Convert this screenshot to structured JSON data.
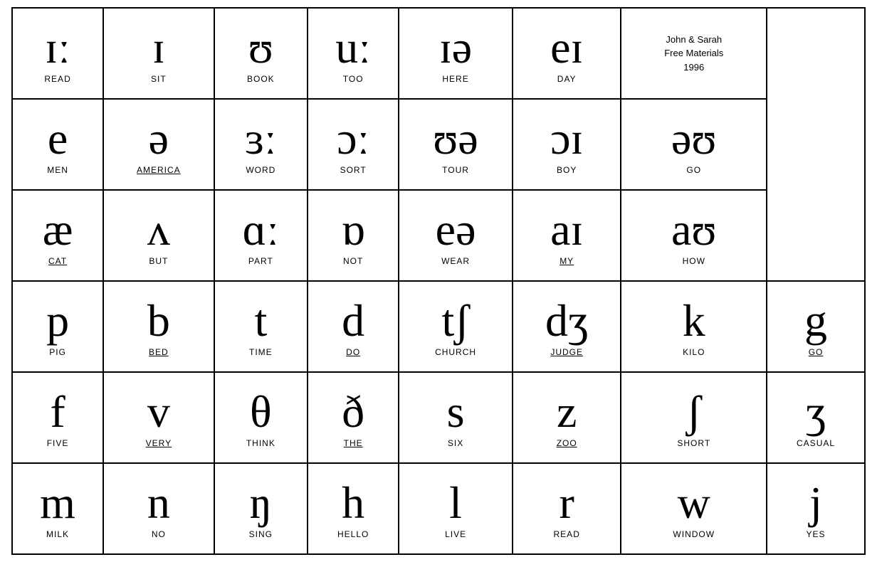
{
  "credit": {
    "line1": "John & Sarah",
    "line2": "Free Materials",
    "line3": "1996"
  },
  "rows": [
    {
      "cells": [
        {
          "symbol": "ɪː",
          "word": "READ",
          "underline": false
        },
        {
          "symbol": "ɪ",
          "word": "SIT",
          "underline": false
        },
        {
          "symbol": "ʊ",
          "word": "BOOK",
          "underline": false
        },
        {
          "symbol": "uː",
          "word": "TOO",
          "underline": false
        },
        {
          "symbol": "ɪə",
          "word": "HERE",
          "underline": false
        },
        {
          "symbol": "eɪ",
          "word": "DAY",
          "underline": false
        },
        {
          "credit": true
        }
      ]
    },
    {
      "cells": [
        {
          "symbol": "e",
          "word": "MEN",
          "underline": false
        },
        {
          "symbol": "ə",
          "word": "AMERICA",
          "underline": true
        },
        {
          "symbol": "ɜː",
          "word": "WORD",
          "underline": false
        },
        {
          "symbol": "ɔː",
          "word": "SORT",
          "underline": false
        },
        {
          "symbol": "ʊə",
          "word": "TOUR",
          "underline": false
        },
        {
          "symbol": "ɔɪ",
          "word": "BOY",
          "underline": false
        },
        {
          "symbol": "əʊ",
          "word": "GO",
          "underline": false
        }
      ]
    },
    {
      "cells": [
        {
          "symbol": "æ",
          "word": "CAT",
          "underline": true
        },
        {
          "symbol": "ʌ",
          "word": "BUT",
          "underline": false
        },
        {
          "symbol": "ɑː",
          "word": "PART",
          "underline": false
        },
        {
          "symbol": "ɒ",
          "word": "NOT",
          "underline": false
        },
        {
          "symbol": "eə",
          "word": "WEAR",
          "underline": false
        },
        {
          "symbol": "aɪ",
          "word": "MY",
          "underline": true
        },
        {
          "symbol": "aʊ",
          "word": "HOW",
          "underline": false
        }
      ]
    },
    {
      "cells": [
        {
          "symbol": "p",
          "word": "PIG",
          "underline": false
        },
        {
          "symbol": "b",
          "word": "BED",
          "underline": true
        },
        {
          "symbol": "t",
          "word": "TIME",
          "underline": false
        },
        {
          "symbol": "d",
          "word": "DO",
          "underline": true
        },
        {
          "symbol": "tʃ",
          "word": "CHURCH",
          "underline": false
        },
        {
          "symbol": "dʒ",
          "word": "JUDGE",
          "underline": true
        },
        {
          "symbol": "k",
          "word": "KILO",
          "underline": false
        },
        {
          "symbol": "g",
          "word": "GO",
          "underline": true
        }
      ]
    },
    {
      "cells": [
        {
          "symbol": "f",
          "word": "FIVE",
          "underline": false
        },
        {
          "symbol": "v",
          "word": "VERY",
          "underline": true
        },
        {
          "symbol": "θ",
          "word": "THINK",
          "underline": false
        },
        {
          "symbol": "ð",
          "word": "THE",
          "underline": true
        },
        {
          "symbol": "s",
          "word": "SIX",
          "underline": false
        },
        {
          "symbol": "z",
          "word": "ZOO",
          "underline": true
        },
        {
          "symbol": "ʃ",
          "word": "SHORT",
          "underline": false
        },
        {
          "symbol": "ʒ",
          "word": "CASUAL",
          "underline": false
        }
      ]
    },
    {
      "cells": [
        {
          "symbol": "m",
          "word": "MILK",
          "underline": false
        },
        {
          "symbol": "n",
          "word": "NO",
          "underline": false
        },
        {
          "symbol": "ŋ",
          "word": "SING",
          "underline": false
        },
        {
          "symbol": "h",
          "word": "HELLO",
          "underline": false
        },
        {
          "symbol": "l",
          "word": "LIVE",
          "underline": false
        },
        {
          "symbol": "r",
          "word": "READ",
          "underline": false
        },
        {
          "symbol": "w",
          "word": "WINDOW",
          "underline": false
        },
        {
          "symbol": "j",
          "word": "YES",
          "underline": false
        }
      ]
    }
  ]
}
